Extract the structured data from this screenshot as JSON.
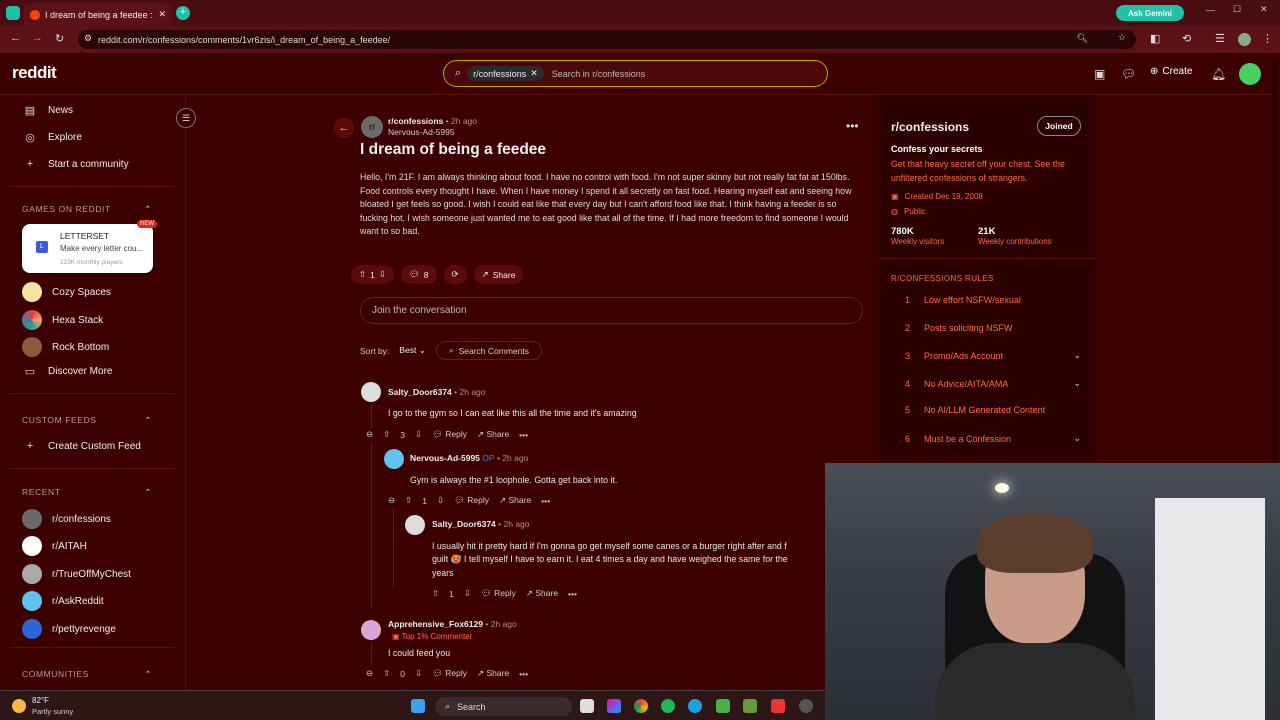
{
  "browser": {
    "tab_title": "I dream of being a feedee : r/co",
    "url": "reddit.com/r/confessions/comments/1vr6zis/i_dream_of_being_a_feedee/",
    "gemini_label": "Ask Gemini"
  },
  "header": {
    "logo": "reddit",
    "search_chip": "r/confessions",
    "search_placeholder": "Search in r/confessions",
    "create_label": "Create"
  },
  "sidebar": {
    "nav": [
      {
        "label": "News",
        "icon": "news-icon"
      },
      {
        "label": "Explore",
        "icon": "explore-icon"
      },
      {
        "label": "Start a community",
        "icon": "plus-icon"
      }
    ],
    "games_header": "GAMES ON REDDIT",
    "letterset": {
      "title": "LETTERSET",
      "subtitle": "Make every letter cou...",
      "players": "123K monthly players",
      "badge": "NEW"
    },
    "games": [
      "Cozy Spaces",
      "Hexa Stack",
      "Rock Bottom",
      "Discover More"
    ],
    "custom_header": "CUSTOM FEEDS",
    "create_feed": "Create Custom Feed",
    "recent_header": "RECENT",
    "recent": [
      "r/confessions",
      "r/AITAH",
      "r/TrueOffMyChest",
      "r/AskReddit",
      "r/pettyrevenge"
    ],
    "communities_header": "COMMUNITIES"
  },
  "post": {
    "subreddit": "r/confessions",
    "time": "2h ago",
    "author": "Nervous-Ad-5995",
    "title": "I dream of being a feedee",
    "body": "Hello, I'm 21F. I am always thinking about food. I have no control with food. I'm not super skinny but not really fat fat at 150lbs. Food controls every thought I have. When I have money I spend it all secretly on fast food. Hearing myself eat and seeing how bloated I get feels so good. I wish I could eat like that every day but I can't afford food like that. I think having a feeder is so fucking hot. I wish someone just wanted me to eat good like that all of the time. If I had more freedom to find someone I would want to so bad.",
    "votes": "1",
    "comments": "8",
    "share": "Share",
    "join_placeholder": "Join the conversation",
    "sort_label": "Sort by:",
    "sort_value": "Best",
    "search_comments": "Search Comments"
  },
  "comments": [
    {
      "author": "Salty_Door6374",
      "time": "2h ago",
      "text": "I go to the gym so I can eat like this all the time and it's amazing",
      "votes": "3",
      "reply": "Reply",
      "share": "Share"
    },
    {
      "author": "Nervous-Ad-5995",
      "op": "OP",
      "time": "2h ago",
      "text": "Gym is always the #1 loophole. Gotta get back into it.",
      "votes": "1",
      "reply": "Reply",
      "share": "Share"
    },
    {
      "author": "Salty_Door6374",
      "time": "2h ago",
      "text_line1": "I usually hit it pretty hard if I'm gonna go get myself some canes or a burger right after and f",
      "text_line2": "guilt 🥵 I tell myself I have to earn it. I eat 4 times a day and have weighed the same for the",
      "text_line3": "years",
      "votes": "1",
      "reply": "Reply",
      "share": "Share"
    },
    {
      "author": "Apprehensive_Fox6129",
      "time": "2h ago",
      "flair": "Top 1% Commenter",
      "text": "I could feed you",
      "votes": "0",
      "reply": "Reply",
      "share": "Share"
    }
  ],
  "community": {
    "name": "r/confessions",
    "joined": "Joined",
    "tagline": "Confess your secrets",
    "description": "Get that heavy secret off your chest. See the unfiltered confessions of strangers.",
    "created": "Created Dec 19, 2008",
    "visibility": "Public",
    "visitors": "780K",
    "visitors_label": "Weekly visitors",
    "contributions": "21K",
    "contributions_label": "Weekly contributions",
    "rules_header": "R/CONFESSIONS RULES",
    "rules": [
      {
        "n": "1",
        "label": "Low effort NSFW/sexual",
        "expand": false
      },
      {
        "n": "2",
        "label": "Posts soliciting NSFW",
        "expand": false
      },
      {
        "n": "3",
        "label": "Promo/Ads Account",
        "expand": true
      },
      {
        "n": "4",
        "label": "No Advice/AITA/AMA",
        "expand": true
      },
      {
        "n": "5",
        "label": "No AI/LLM Generated Content",
        "expand": false
      },
      {
        "n": "6",
        "label": "Must be a Confession",
        "expand": true
      }
    ]
  },
  "taskbar": {
    "temp": "82°F",
    "weather": "Partly sunny",
    "search": "Search"
  }
}
